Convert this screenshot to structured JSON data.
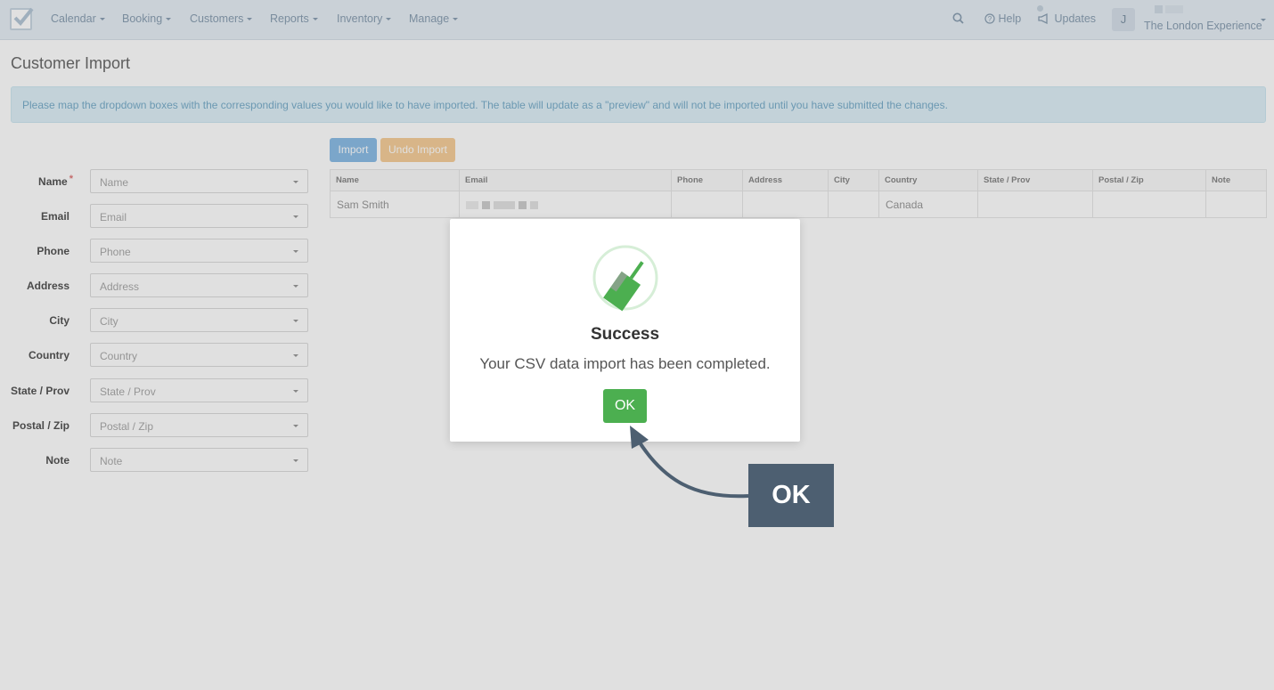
{
  "nav": {
    "items": [
      "Calendar",
      "Booking",
      "Customers",
      "Reports",
      "Inventory",
      "Manage"
    ],
    "help": "Help",
    "updates": "Updates",
    "avatar_initial": "J",
    "account_name": "The London Experience"
  },
  "page": {
    "title": "Customer Import",
    "info": "Please map the dropdown boxes with the corresponding values you would like to have imported. The table will update as a \"preview\" and will not be imported until you have submitted the changes."
  },
  "mapping": [
    {
      "label": "Name",
      "value": "Name",
      "required": "*"
    },
    {
      "label": "Email",
      "value": "Email"
    },
    {
      "label": "Phone",
      "value": "Phone"
    },
    {
      "label": "Address",
      "value": "Address"
    },
    {
      "label": "City",
      "value": "City"
    },
    {
      "label": "Country",
      "value": "Country"
    },
    {
      "label": "State / Prov",
      "value": "State / Prov"
    },
    {
      "label": "Postal / Zip",
      "value": "Postal / Zip"
    },
    {
      "label": "Note",
      "value": "Note"
    }
  ],
  "buttons": {
    "import": "Import",
    "undo_import": "Undo Import"
  },
  "preview_table": {
    "columns": [
      "Name",
      "Email",
      "Phone",
      "Address",
      "City",
      "Country",
      "State / Prov",
      "Postal / Zip",
      "Note"
    ],
    "rows": [
      {
        "name": "Sam Smith",
        "email": "",
        "phone": "",
        "address": "",
        "city": "",
        "country": "Canada",
        "state": "",
        "postal": "",
        "note": ""
      }
    ]
  },
  "modal": {
    "title": "Success",
    "message": "Your CSV data import has been completed.",
    "ok_label": "OK",
    "icon": "success-brush-icon"
  },
  "annotation": {
    "label": "OK"
  },
  "colors": {
    "success_green": "#4caf50",
    "callout_bg": "#4d5f71",
    "import_blue": "#8cbde6",
    "undo_orange": "#f6cf9b"
  }
}
